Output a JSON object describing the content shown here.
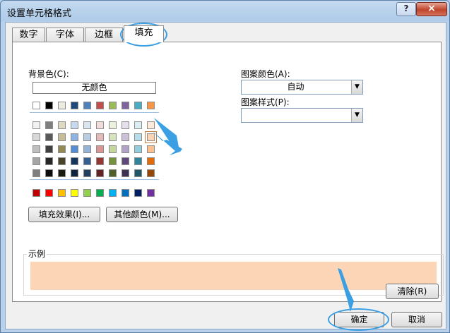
{
  "window": {
    "title": "设置单元格格式",
    "help_icon": "?",
    "close_icon": "×"
  },
  "tabs": [
    {
      "label": "数字"
    },
    {
      "label": "字体"
    },
    {
      "label": "边框"
    },
    {
      "label": "填充",
      "selected": true
    }
  ],
  "fill": {
    "background_label": "背景色(C):",
    "no_color_label": "无颜色",
    "fill_effects_button": "填充效果(I)...",
    "more_colors_button": "其他颜色(M)...",
    "pattern_color_label": "图案颜色(A):",
    "pattern_color_value": "自动",
    "pattern_style_label": "图案样式(P):",
    "pattern_style_value": "",
    "sample_label": "示例",
    "sample_color": "#fbd5b5",
    "selected_swatch": "#fbd5b5",
    "theme_colors_row1": [
      "#ffffff",
      "#000000",
      "#eeece1",
      "#1f497d",
      "#4f81bd",
      "#c0504d",
      "#9bbb59",
      "#8064a2",
      "#4bacc6",
      "#f79646"
    ],
    "theme_colors_grid": [
      [
        "#f2f2f2",
        "#7f7f7f",
        "#ddd9c3",
        "#c6d9f0",
        "#dbe5f1",
        "#f2dcdb",
        "#ebf1dd",
        "#e5e0ec",
        "#dbeef3",
        "#fdeada"
      ],
      [
        "#d8d8d8",
        "#595959",
        "#c4bd97",
        "#8db3e2",
        "#b8cce4",
        "#e5b9b7",
        "#d7e3bc",
        "#ccc1d9",
        "#b7dde8",
        "#fbd5b5"
      ],
      [
        "#bfbfbf",
        "#3f3f3f",
        "#938953",
        "#548dd4",
        "#95b3d7",
        "#d99694",
        "#c3d69b",
        "#b2a2c7",
        "#92cddc",
        "#fac08f"
      ],
      [
        "#a5a5a5",
        "#262626",
        "#494429",
        "#17365d",
        "#366092",
        "#953734",
        "#76923c",
        "#5f497a",
        "#31859b",
        "#e36c09"
      ],
      [
        "#7f7f7f",
        "#0c0c0c",
        "#1d1b10",
        "#0f243e",
        "#244061",
        "#632423",
        "#4f6128",
        "#3f3151",
        "#205867",
        "#974806"
      ]
    ],
    "standard_colors": [
      "#c00000",
      "#ff0000",
      "#ffc000",
      "#ffff00",
      "#92d050",
      "#00b050",
      "#00b0f0",
      "#0070c0",
      "#002060",
      "#7030a0"
    ]
  },
  "buttons": {
    "clear": "清除(R)",
    "ok": "确定",
    "cancel": "取消"
  },
  "annotation_color": "#3b9fe3"
}
